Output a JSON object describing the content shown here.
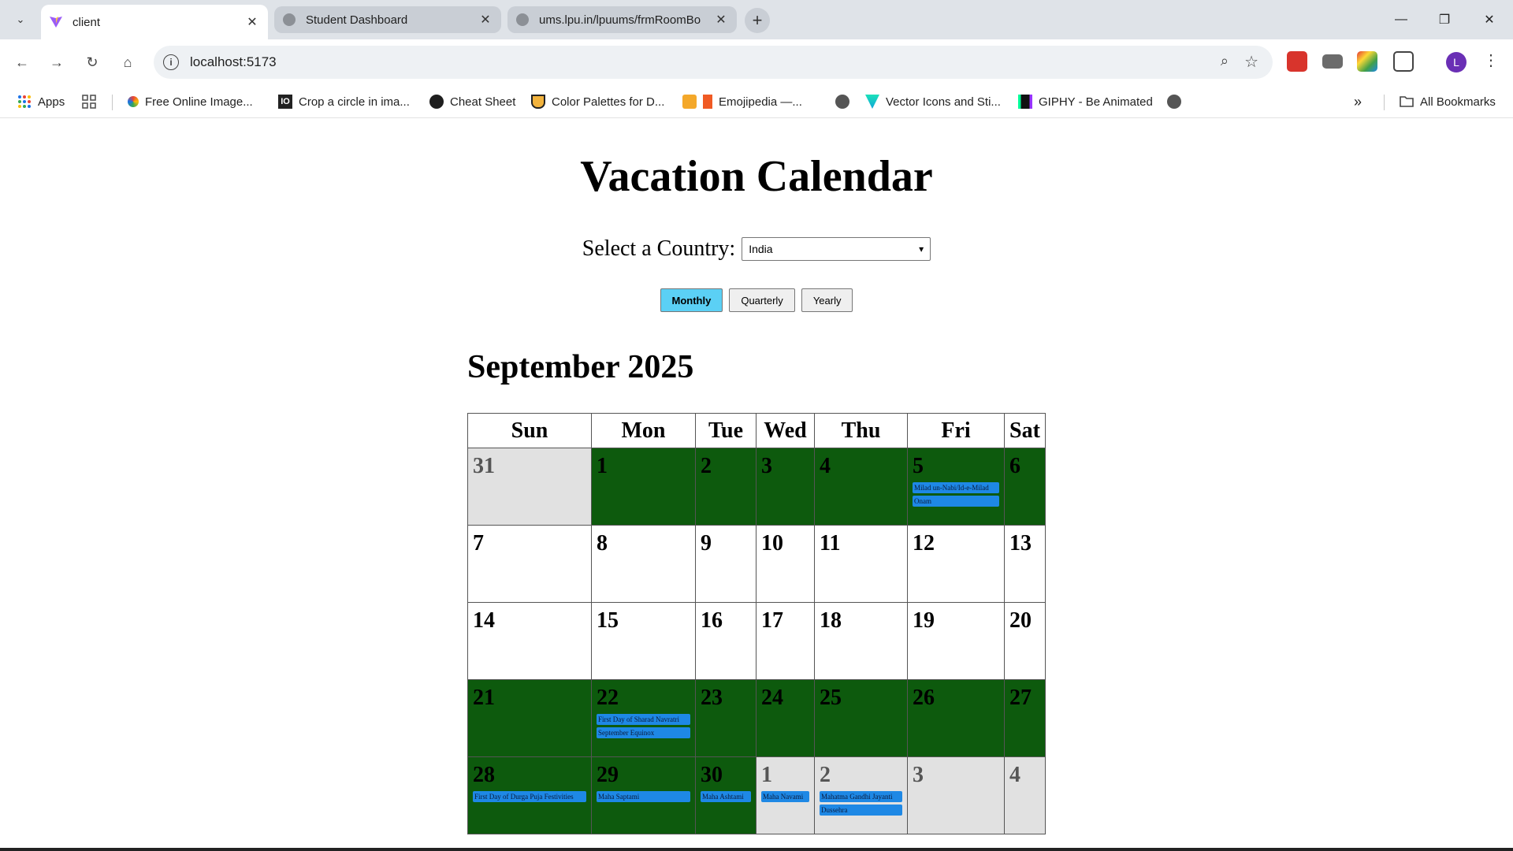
{
  "browser": {
    "tabs": [
      {
        "title": "client",
        "active": true
      },
      {
        "title": "Student Dashboard",
        "active": false
      },
      {
        "title": "ums.lpu.in/lpuums/frmRoomBo",
        "active": false
      }
    ],
    "url": "localhost:5173",
    "profile_initial": "L",
    "bookmarks": [
      {
        "label": "Apps"
      },
      {
        "label": "Free Online Image..."
      },
      {
        "label": "Crop a circle in ima..."
      },
      {
        "label": "Cheat Sheet"
      },
      {
        "label": "Color Palettes for D..."
      },
      {
        "label": "Emojipedia —..."
      },
      {
        "label": "Vector Icons and Sti..."
      },
      {
        "label": "GIPHY - Be Animated"
      }
    ],
    "all_bookmarks": "All Bookmarks"
  },
  "page": {
    "title": "Vacation Calendar",
    "country_label": "Select a Country:",
    "country_selected": "India",
    "views": {
      "monthly": "Monthly",
      "quarterly": "Quarterly",
      "yearly": "Yearly",
      "active": "Monthly"
    },
    "month_title": "September 2025",
    "weekdays": [
      "Sun",
      "Mon",
      "Tue",
      "Wed",
      "Thu",
      "Fri",
      "Sat"
    ],
    "weeks": [
      [
        {
          "day": "31",
          "type": "other",
          "events": []
        },
        {
          "day": "1",
          "type": "hol",
          "events": []
        },
        {
          "day": "2",
          "type": "hol",
          "events": []
        },
        {
          "day": "3",
          "type": "hol",
          "events": []
        },
        {
          "day": "4",
          "type": "hol",
          "events": []
        },
        {
          "day": "5",
          "type": "hol",
          "events": [
            "Milad un-Nabi/Id-e-Milad",
            "Onam"
          ]
        },
        {
          "day": "6",
          "type": "hol",
          "events": []
        }
      ],
      [
        {
          "day": "7",
          "type": "norm",
          "events": []
        },
        {
          "day": "8",
          "type": "norm",
          "events": []
        },
        {
          "day": "9",
          "type": "norm",
          "events": []
        },
        {
          "day": "10",
          "type": "norm",
          "events": []
        },
        {
          "day": "11",
          "type": "norm",
          "events": []
        },
        {
          "day": "12",
          "type": "norm",
          "events": []
        },
        {
          "day": "13",
          "type": "norm",
          "events": []
        }
      ],
      [
        {
          "day": "14",
          "type": "norm",
          "events": []
        },
        {
          "day": "15",
          "type": "norm",
          "events": []
        },
        {
          "day": "16",
          "type": "norm",
          "events": []
        },
        {
          "day": "17",
          "type": "norm",
          "events": []
        },
        {
          "day": "18",
          "type": "norm",
          "events": []
        },
        {
          "day": "19",
          "type": "norm",
          "events": []
        },
        {
          "day": "20",
          "type": "norm",
          "events": []
        }
      ],
      [
        {
          "day": "21",
          "type": "hol",
          "events": []
        },
        {
          "day": "22",
          "type": "hol",
          "events": [
            "First Day of Sharad Navratri",
            "September Equinox"
          ]
        },
        {
          "day": "23",
          "type": "hol",
          "events": []
        },
        {
          "day": "24",
          "type": "hol",
          "events": []
        },
        {
          "day": "25",
          "type": "hol",
          "events": []
        },
        {
          "day": "26",
          "type": "hol",
          "events": []
        },
        {
          "day": "27",
          "type": "hol",
          "events": []
        }
      ],
      [
        {
          "day": "28",
          "type": "hol",
          "events": [
            "First Day of Durga Puja Festivities"
          ]
        },
        {
          "day": "29",
          "type": "hol",
          "events": [
            "Maha Saptami"
          ]
        },
        {
          "day": "30",
          "type": "hol",
          "events": [
            "Maha Ashtami"
          ]
        },
        {
          "day": "1",
          "type": "other",
          "events": [
            "Maha Navami"
          ]
        },
        {
          "day": "2",
          "type": "other",
          "events": [
            "Mahatma Gandhi Jayanti",
            "Dussehra"
          ]
        },
        {
          "day": "3",
          "type": "other",
          "events": []
        },
        {
          "day": "4",
          "type": "other",
          "events": []
        }
      ]
    ]
  },
  "colors": {
    "holiday_week": "#0d5a0d",
    "other_month": "#e1e1e1",
    "event_chip": "#1e88e5",
    "active_view": "#5bd0f5"
  }
}
